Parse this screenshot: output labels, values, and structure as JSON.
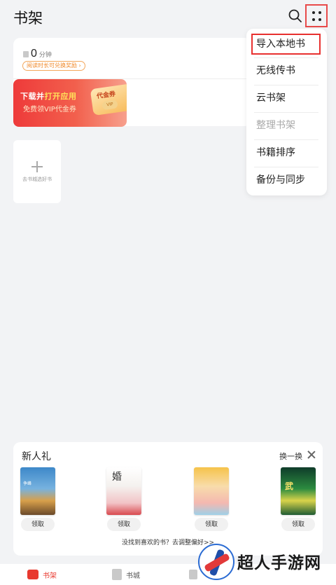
{
  "header": {
    "title": "书架"
  },
  "reading": {
    "minutes": "0",
    "unit": "分钟",
    "reward_text": "阅读时长可兑换奖励 ›"
  },
  "banner": {
    "title_part1": "下载并",
    "title_highlight": "打开应用",
    "subtitle": "免费领VIP代金券",
    "coupon_label": "代金券",
    "coupon_vip": "VIP"
  },
  "add_book": {
    "label": "去书城选好书"
  },
  "menu": {
    "items": [
      {
        "label": "导入本地书"
      },
      {
        "label": "无线传书"
      },
      {
        "label": "云书架"
      },
      {
        "label": "整理书架"
      },
      {
        "label": "书籍排序"
      },
      {
        "label": "备份与同步"
      }
    ]
  },
  "gift": {
    "title": "新人礼",
    "refresh": "换一换",
    "claim_label": "领取",
    "books": [
      {
        "cover_text": "争峰"
      },
      {
        "cover_text": "婚"
      },
      {
        "cover_text": ""
      },
      {
        "cover_text": "武"
      }
    ],
    "prefs_link": "没找到喜欢的书？去调整偏好>>"
  },
  "nav": {
    "items": [
      {
        "label": "书架"
      },
      {
        "label": "书城"
      }
    ]
  },
  "watermark": {
    "text": "超人手游网"
  },
  "colors": {
    "accent": "#e8392f",
    "highlight_border": "#e8302f"
  }
}
